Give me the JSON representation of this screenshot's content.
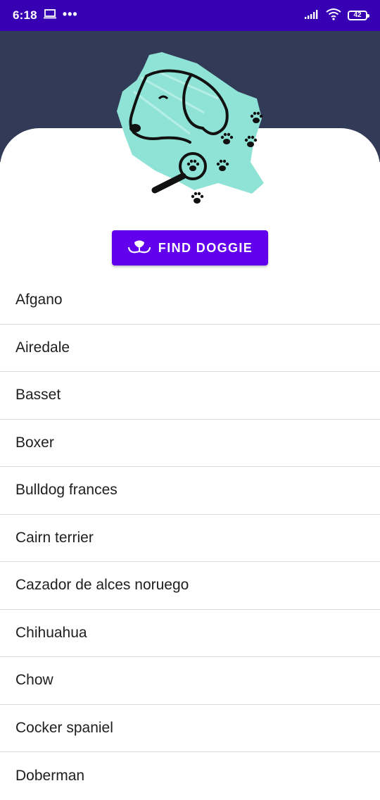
{
  "status_bar": {
    "time": "6:18",
    "dots": "•••",
    "battery": "42",
    "icons": [
      "laptop-icon",
      "signal-icon",
      "wifi-icon",
      "battery-icon"
    ]
  },
  "header": {
    "logo": "dog-magnifier-paws-logo",
    "colors": {
      "header": "#313a56",
      "logo_splash": "#8fe3d6"
    }
  },
  "find_button": {
    "label": "FIND DOGGIE",
    "icon": "dog-nose-icon",
    "color": "#6200ee"
  },
  "breeds": [
    "Afgano",
    "Airedale",
    "Basset",
    "Boxer",
    "Bulldog frances",
    "Cairn terrier",
    "Cazador de alces noruego",
    "Chihuahua",
    "Chow",
    "Cocker spaniel",
    "Doberman"
  ],
  "colors": {
    "status_bar": "#3700b3",
    "accent": "#6200ee"
  }
}
